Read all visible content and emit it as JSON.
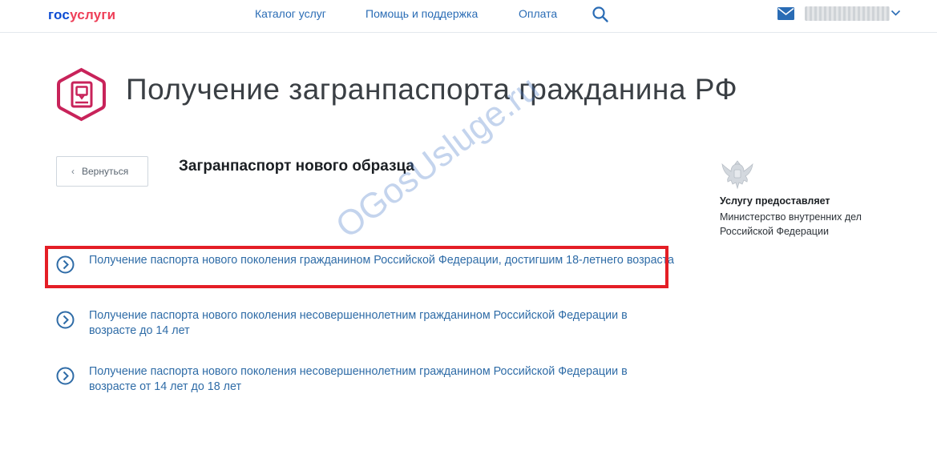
{
  "header": {
    "logo_part1": "гос",
    "logo_part2": "услуги",
    "nav": {
      "catalog": "Каталог услуг",
      "help": "Помощь и поддержка",
      "payment": "Оплата"
    },
    "user_name": "████████"
  },
  "page": {
    "title": "Получение загранпаспорта гражданина РФ",
    "back_label": "Вернуться",
    "section_title": "Загранпаспорт нового образца",
    "services": [
      {
        "label": "Получение паспорта нового поколения гражданином Российской Федерации, достигшим 18-летнего возраста"
      },
      {
        "label": "Получение паспорта нового поколения несовершеннолетним гражданином Российской Федерации в возрасте до 14 лет"
      },
      {
        "label": "Получение паспорта нового поколения несовершеннолетним гражданином Российской Федерации в возрасте от 14 лет до 18 лет"
      }
    ]
  },
  "provider": {
    "label": "Услугу предоставляет",
    "name": "Министерство внутренних дел Российской Федерации"
  },
  "watermark": "OGosUsluge.ru",
  "colors": {
    "brand_blue": "#0d4cd3",
    "brand_red": "#ee3f58",
    "link": "#2f6ca7",
    "icon_crimson": "#c8235a",
    "highlight": "#e41e26"
  }
}
